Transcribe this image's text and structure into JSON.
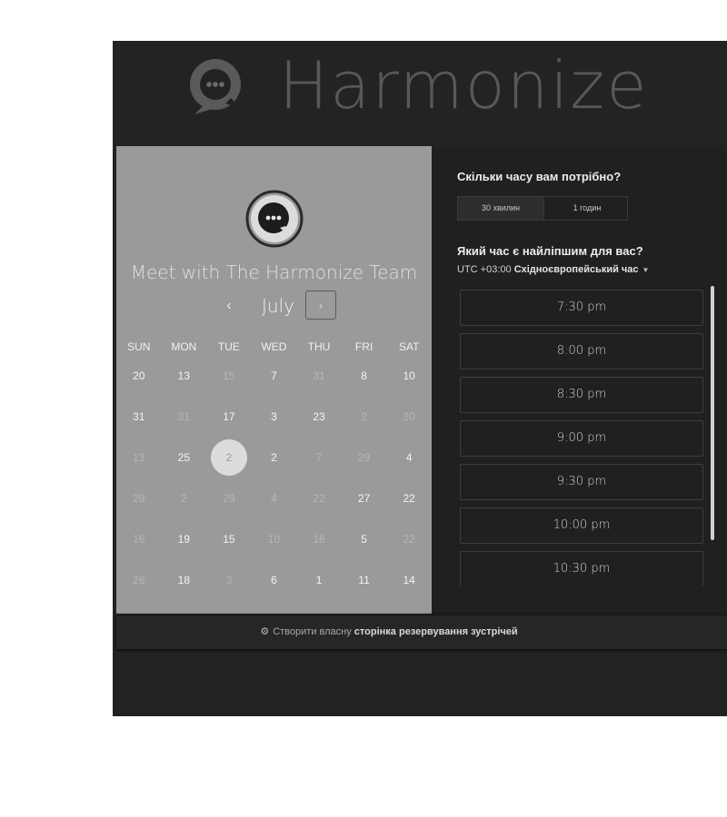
{
  "header": {
    "brand": "Harmonize"
  },
  "organizer": {
    "title": "Meet with The Harmonize Team"
  },
  "calendar": {
    "month": "July",
    "prev_label": "‹",
    "next_label": "›",
    "weekdays": [
      "SUN",
      "MON",
      "TUE",
      "WED",
      "THU",
      "FRI",
      "SAT"
    ],
    "weeks": [
      [
        {
          "d": "20",
          "s": "active"
        },
        {
          "d": "13",
          "s": "active"
        },
        {
          "d": "15",
          "s": "inactive"
        },
        {
          "d": "7",
          "s": "active"
        },
        {
          "d": "31",
          "s": "inactive"
        },
        {
          "d": "8",
          "s": "active"
        },
        {
          "d": "10",
          "s": "active"
        }
      ],
      [
        {
          "d": "31",
          "s": "active"
        },
        {
          "d": "31",
          "s": "inactive"
        },
        {
          "d": "17",
          "s": "active"
        },
        {
          "d": "3",
          "s": "active"
        },
        {
          "d": "23",
          "s": "active"
        },
        {
          "d": "2",
          "s": "inactive"
        },
        {
          "d": "30",
          "s": "inactive"
        }
      ],
      [
        {
          "d": "13",
          "s": "inactive"
        },
        {
          "d": "25",
          "s": "active"
        },
        {
          "d": "2",
          "s": "selected"
        },
        {
          "d": "2",
          "s": "active"
        },
        {
          "d": "7",
          "s": "inactive"
        },
        {
          "d": "29",
          "s": "inactive"
        },
        {
          "d": "4",
          "s": "active"
        }
      ],
      [
        {
          "d": "29",
          "s": "inactive"
        },
        {
          "d": "2",
          "s": "inactive"
        },
        {
          "d": "29",
          "s": "inactive"
        },
        {
          "d": "4",
          "s": "inactive"
        },
        {
          "d": "22",
          "s": "inactive"
        },
        {
          "d": "27",
          "s": "active"
        },
        {
          "d": "22",
          "s": "active"
        }
      ],
      [
        {
          "d": "16",
          "s": "inactive"
        },
        {
          "d": "19",
          "s": "active"
        },
        {
          "d": "15",
          "s": "active"
        },
        {
          "d": "10",
          "s": "inactive"
        },
        {
          "d": "16",
          "s": "inactive"
        },
        {
          "d": "5",
          "s": "active"
        },
        {
          "d": "22",
          "s": "inactive"
        }
      ],
      [
        {
          "d": "26",
          "s": "inactive"
        },
        {
          "d": "18",
          "s": "active"
        },
        {
          "d": "3",
          "s": "inactive"
        },
        {
          "d": "6",
          "s": "active"
        },
        {
          "d": "1",
          "s": "active"
        },
        {
          "d": "11",
          "s": "active"
        },
        {
          "d": "14",
          "s": "active"
        }
      ]
    ]
  },
  "booking": {
    "duration_question": "Скільки часу вам потрібно?",
    "durations": [
      "30 хвилин",
      "1 годин"
    ],
    "selected_duration": "30 хвилин",
    "time_question": "Який час є найліпшим для вас?",
    "timezone_prefix": "UTC +03:00",
    "timezone_name": "Східноєвропейський час",
    "slots": [
      "7:30 pm",
      "8:00 pm",
      "8:30 pm",
      "9:00 pm",
      "9:30 pm",
      "10:00 pm",
      "10:30 pm"
    ]
  },
  "footer": {
    "link_prefix": "Створити власну",
    "link_bold": "сторінка резервування зустрічей"
  },
  "colors": {
    "page_background": "#222222",
    "calendar_panel": "#9a9a9a",
    "selected_day": "#dcdcdc"
  }
}
